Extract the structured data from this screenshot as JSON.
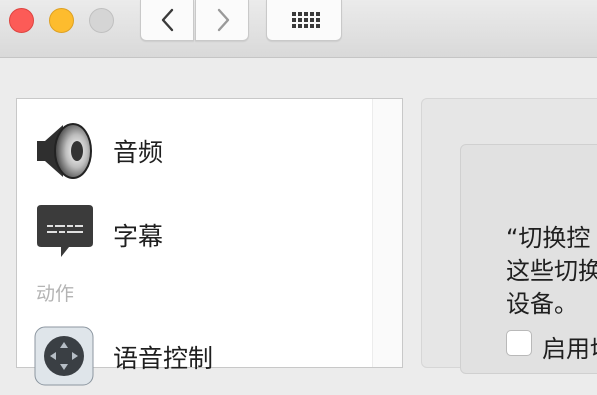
{
  "sidebar": {
    "items": [
      {
        "label": "音频",
        "icon": "speaker-icon"
      },
      {
        "label": "字幕",
        "icon": "captions-icon"
      },
      {
        "label": "语音控制",
        "icon": "voice-control-icon"
      }
    ],
    "section_action": "动作"
  },
  "detail": {
    "line1": "“切换控",
    "line2": "这些切换",
    "line3": "设备。",
    "checkbox_label": "启用切"
  },
  "colors": {
    "close": "#fc5b57",
    "minimize": "#fdbc2e",
    "zoom_disabled": "#d5d5d5"
  }
}
